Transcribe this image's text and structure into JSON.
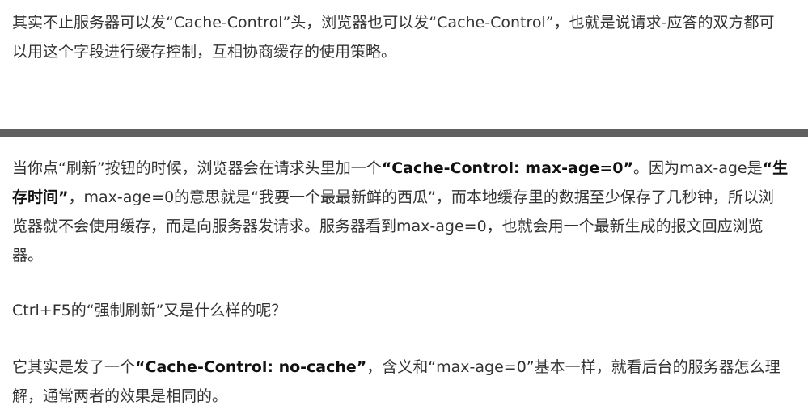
{
  "article": {
    "para1": {
      "text": "其实不止服务器可以发“Cache-Control”头，浏览器也可以发“Cache-Control”，也就是说请求-应答的双方都可以用这个字段进行缓存控制，互相协商缓存的使用策略。"
    },
    "para2": {
      "t1": "当你点“刷新”按钮的时候，浏览器会在请求头里加一个",
      "b1": "“Cache-Control: max-age=0”",
      "t2": "。因为max-age是",
      "b2": "“生存时间”",
      "t3": "，max-age=0的意思就是“我要一个最最新鲜的西瓜”，而本地缓存里的数据至少保存了几秒钟，所以浏览器就不会使用缓存，而是向服务器发请求。服务器看到max-age=0，也就会用一个最新生成的报文回应浏览器。"
    },
    "para3": {
      "text": "Ctrl+F5的“强制刷新”又是什么样的呢？"
    },
    "para4": {
      "t1": "它其实是发了一个",
      "b1": "“Cache-Control: no-cache”",
      "t2": "，含义和“max-age=0”基本一样，就看后台的服务器怎么理解，通常两者的效果是相同的。"
    }
  },
  "colors": {
    "text": "#333333",
    "divider": "#606060"
  }
}
